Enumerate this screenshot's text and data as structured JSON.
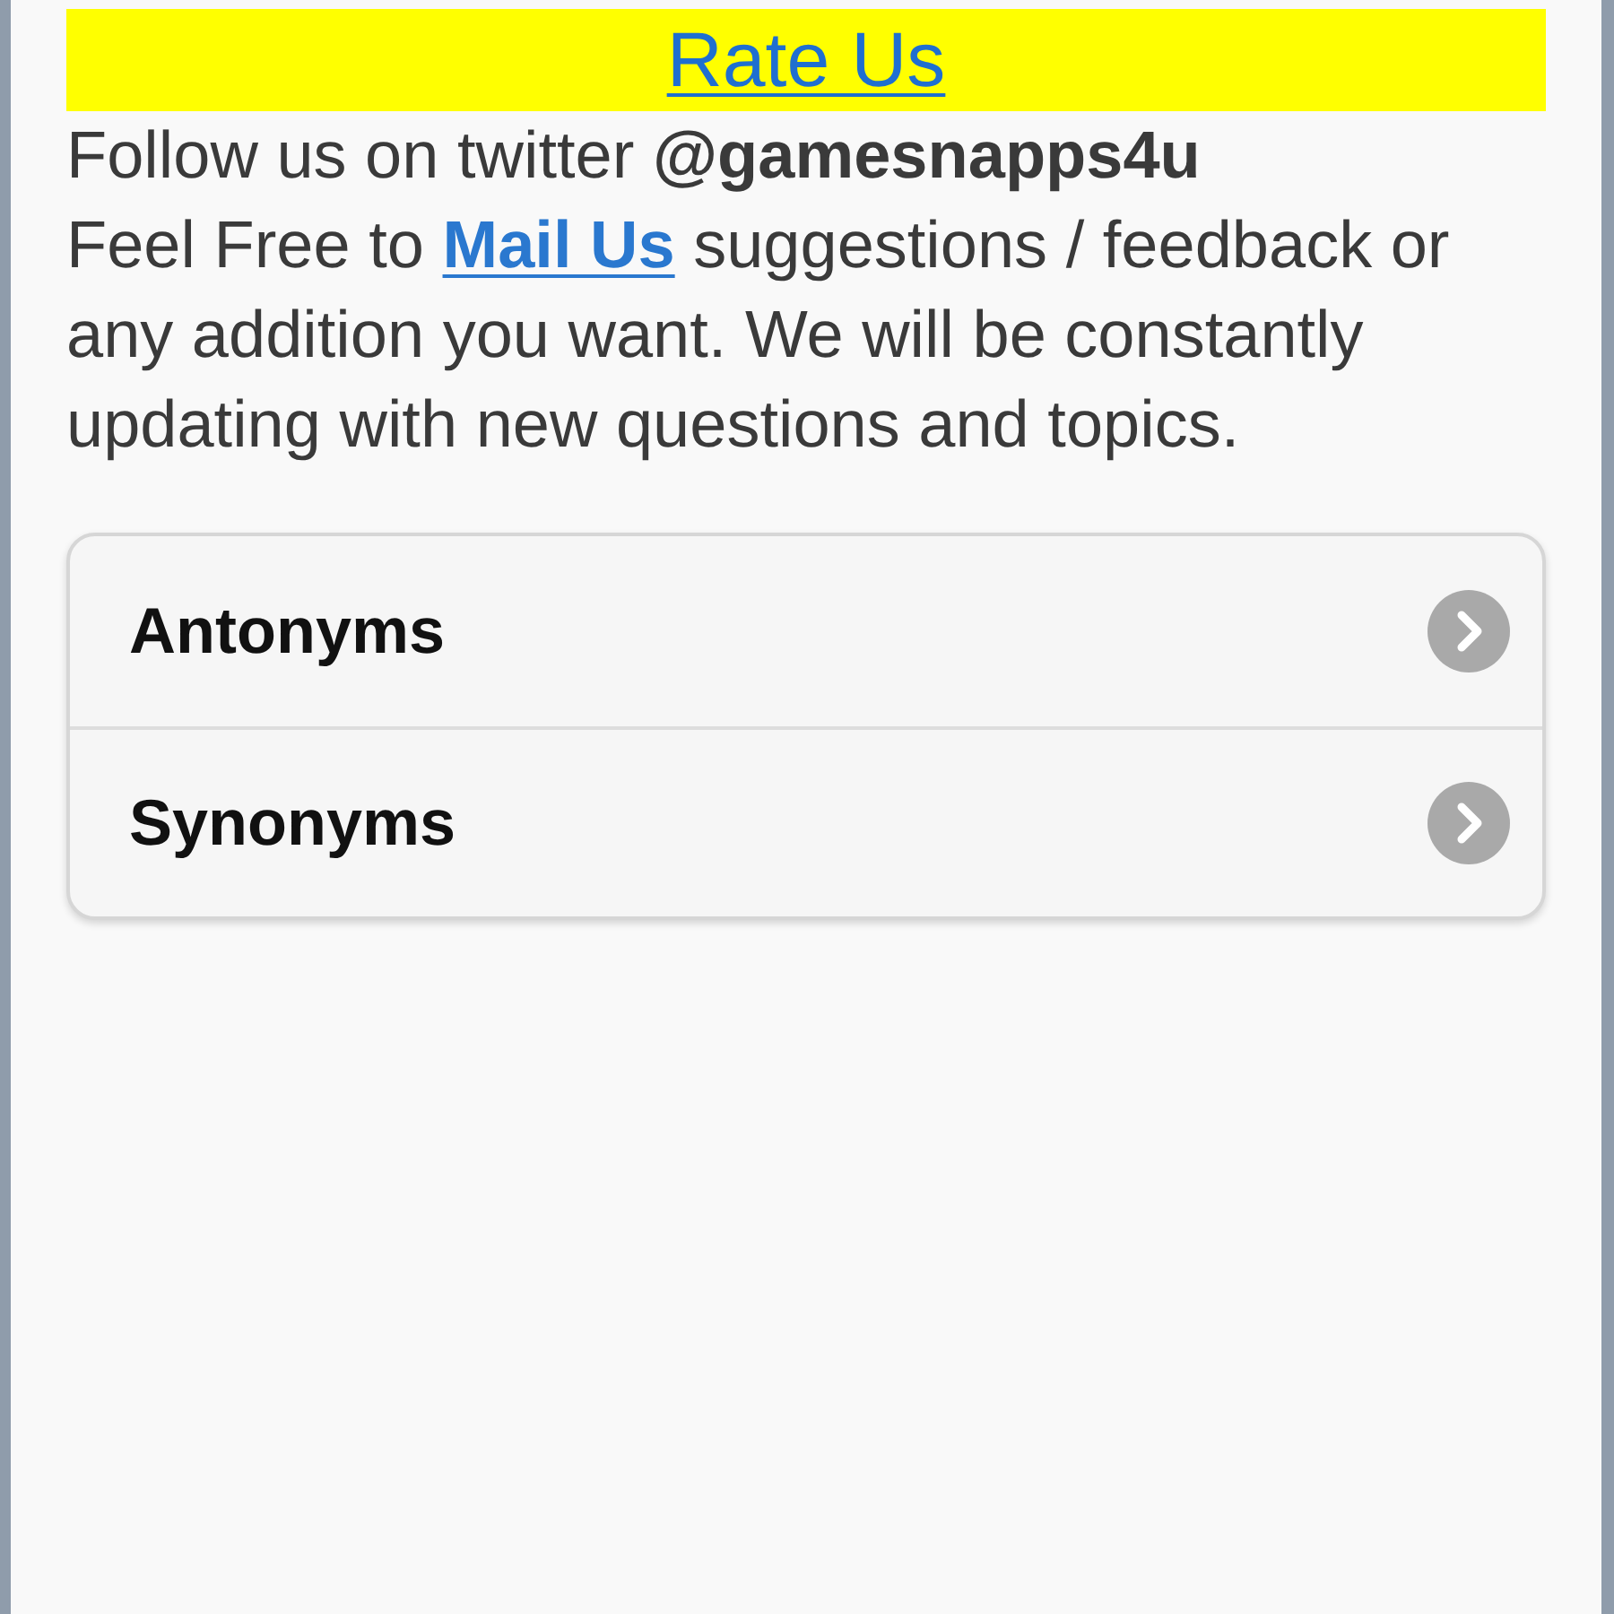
{
  "banner": {
    "link": "Rate Us"
  },
  "follow": {
    "text": "Follow us on twitter **@gamesnapps4u**"
  },
  "feedback": {
    "before": "Feel Free to",
    "link": "Mail Us",
    "after": "suggestions / feedback or any addition you want. We will be constantly updating with new questions and topics."
  },
  "menu": {
    "items": [
      {
        "label": "Antonyms"
      },
      {
        "label": "Synonyms"
      }
    ]
  }
}
